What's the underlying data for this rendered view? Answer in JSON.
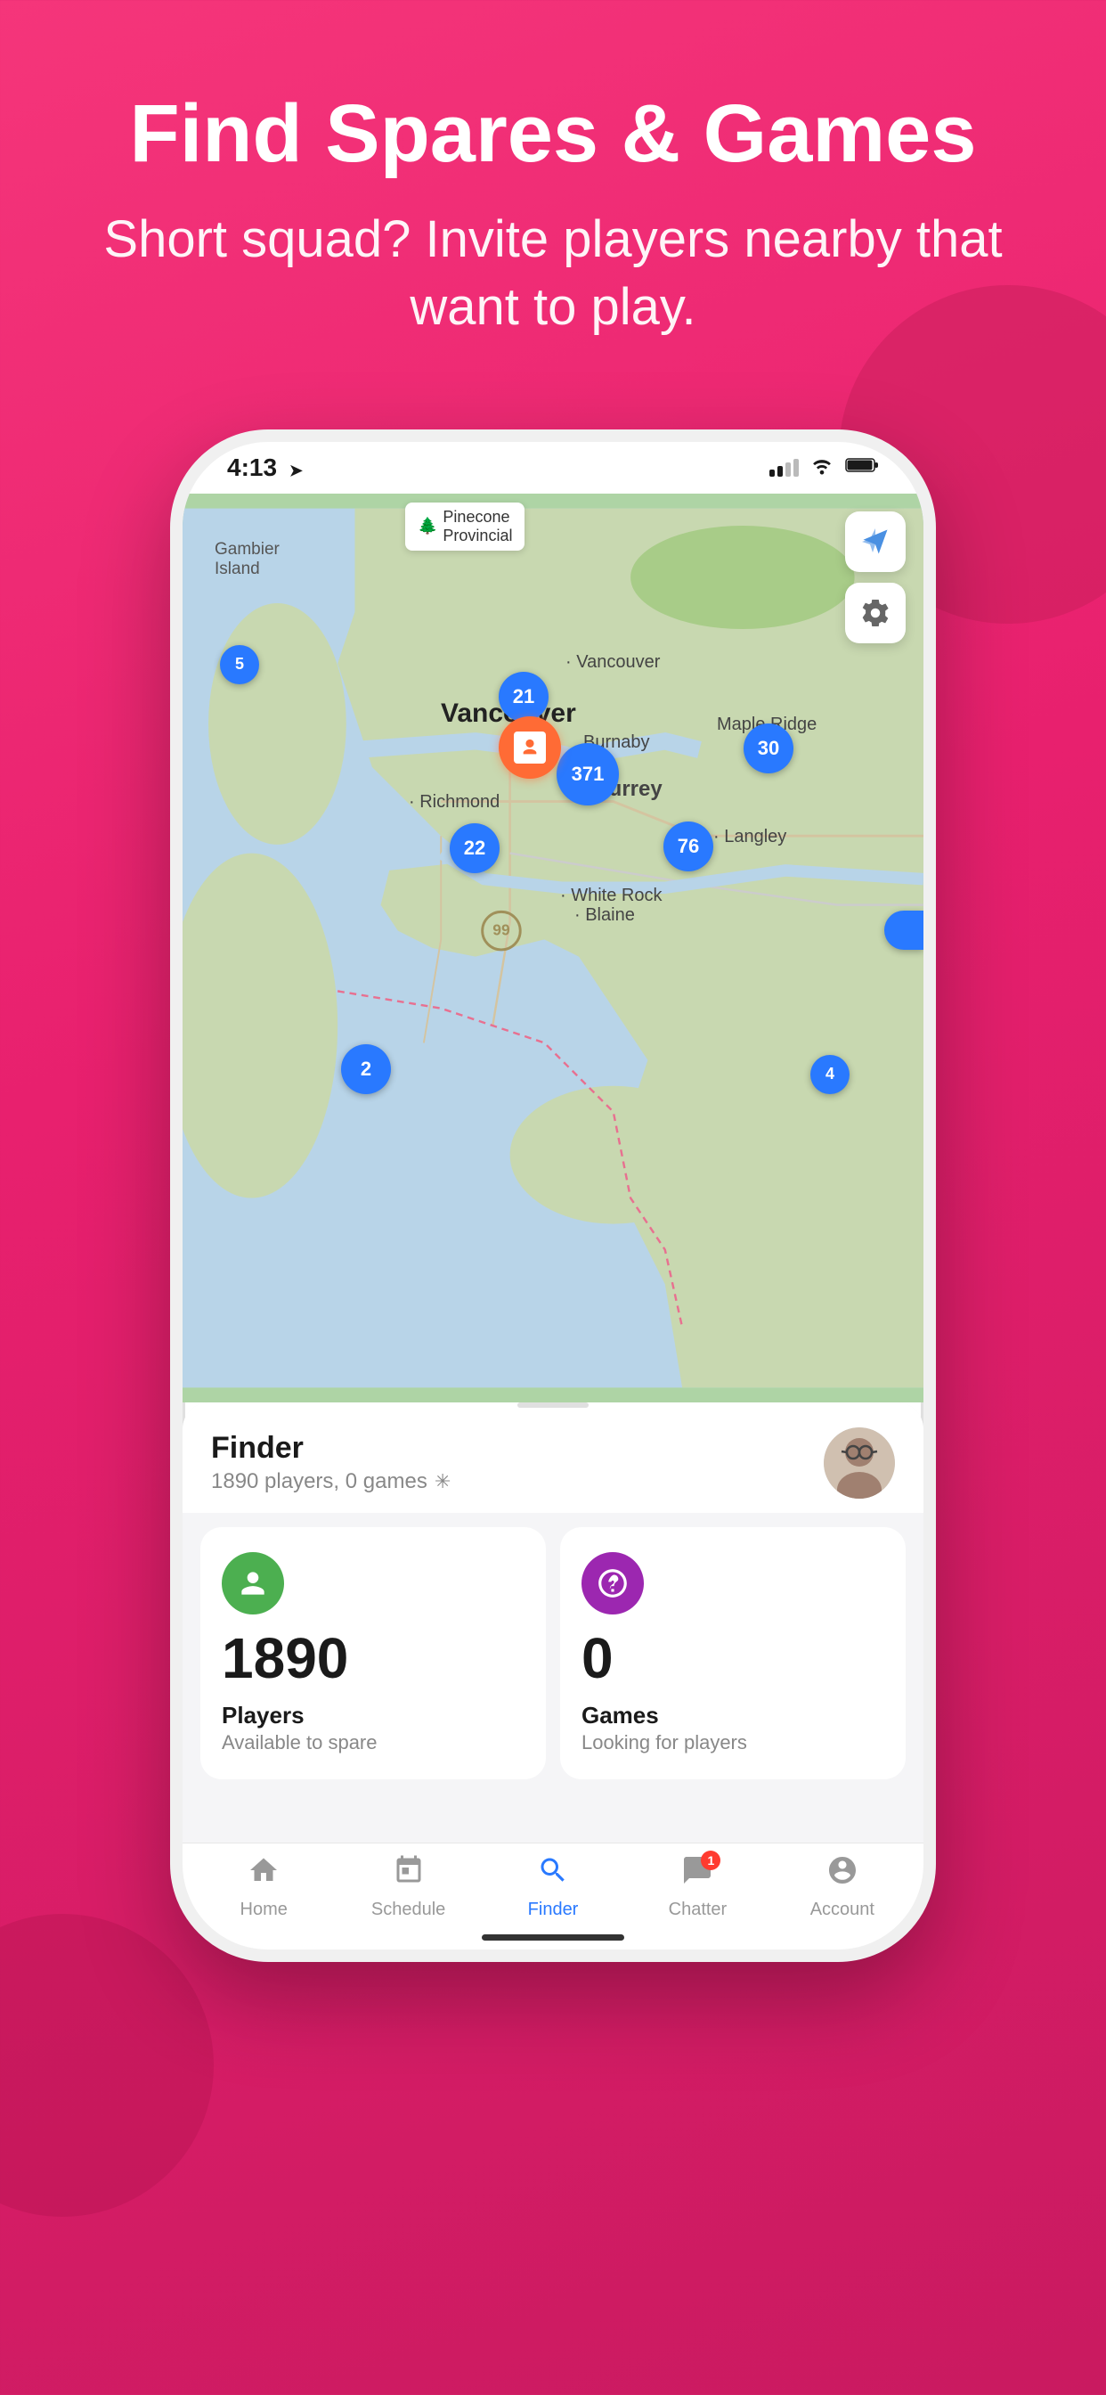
{
  "background": {
    "color_start": "#f5357a",
    "color_end": "#c91a60"
  },
  "hero": {
    "title": "Find Spares & Games",
    "subtitle": "Short squad? Invite players nearby that want to play."
  },
  "phone": {
    "status_bar": {
      "time": "4:13",
      "location_arrow": "▸",
      "signal": "2 bars",
      "wifi": "wifi",
      "battery": "full"
    },
    "map": {
      "markers": [
        {
          "id": "m1",
          "label": "5",
          "size": "sm",
          "top": "170",
          "left": "42"
        },
        {
          "id": "m2",
          "label": "21",
          "size": "md",
          "top": "200",
          "left": "385"
        },
        {
          "id": "m3",
          "label": "371",
          "size": "lg",
          "top": "280",
          "left": "445"
        },
        {
          "id": "m4",
          "label": "22",
          "size": "md",
          "top": "380",
          "left": "340"
        },
        {
          "id": "m5",
          "label": "76",
          "size": "md",
          "top": "380",
          "left": "565"
        },
        {
          "id": "m6",
          "label": "30",
          "size": "md",
          "top": "270",
          "left": "660"
        },
        {
          "id": "m7",
          "label": "2",
          "size": "md",
          "top": "620",
          "left": "215"
        },
        {
          "id": "m8",
          "label": "4",
          "size": "sm",
          "top": "635",
          "left": "730"
        }
      ],
      "user_marker": {
        "top": "252",
        "left": "390"
      },
      "city_labels": [
        {
          "id": "c1",
          "text": "Vancouver",
          "top": "178",
          "left": "465"
        },
        {
          "id": "c2",
          "text": "Vancouver",
          "top": "235",
          "left": "340",
          "size": "large"
        },
        {
          "id": "c3",
          "text": "Burnaby",
          "top": "265",
          "left": "490"
        },
        {
          "id": "c4",
          "text": "Richmond",
          "top": "340",
          "left": "288"
        },
        {
          "id": "c5",
          "text": "Surrey",
          "top": "320",
          "left": "480"
        },
        {
          "id": "c6",
          "text": "Maple Ridge",
          "top": "250",
          "left": "640"
        },
        {
          "id": "c7",
          "text": "Langley",
          "top": "375",
          "left": "620"
        },
        {
          "id": "c8",
          "text": "White Rock",
          "top": "445",
          "left": "465"
        },
        {
          "id": "c9",
          "text": "Blaine",
          "top": "465",
          "left": "480"
        },
        {
          "id": "c10",
          "text": "Gambier Island",
          "top": "100",
          "left": "36"
        }
      ],
      "pinecone_label": "Pinecone Provincial",
      "location_button_label": "⬆",
      "settings_button_label": "⚙"
    },
    "finder_panel": {
      "title": "Finder",
      "subtitle": "1890 players, 0 games",
      "spinner": "✳",
      "players_count": "1890",
      "players_label": "Players",
      "players_sublabel": "Available to spare",
      "games_count": "0",
      "games_label": "Games",
      "games_sublabel": "Looking for players"
    },
    "bottom_nav": {
      "items": [
        {
          "id": "home",
          "icon": "⌂",
          "label": "Home",
          "active": false,
          "badge": null
        },
        {
          "id": "schedule",
          "icon": "▦",
          "label": "Schedule",
          "active": false,
          "badge": null
        },
        {
          "id": "finder",
          "icon": "⊙",
          "label": "Finder",
          "active": true,
          "badge": null
        },
        {
          "id": "chatter",
          "icon": "💬",
          "label": "Chatter",
          "active": false,
          "badge": "1"
        },
        {
          "id": "account",
          "icon": "◯",
          "label": "Account",
          "active": false,
          "badge": null
        }
      ]
    }
  }
}
